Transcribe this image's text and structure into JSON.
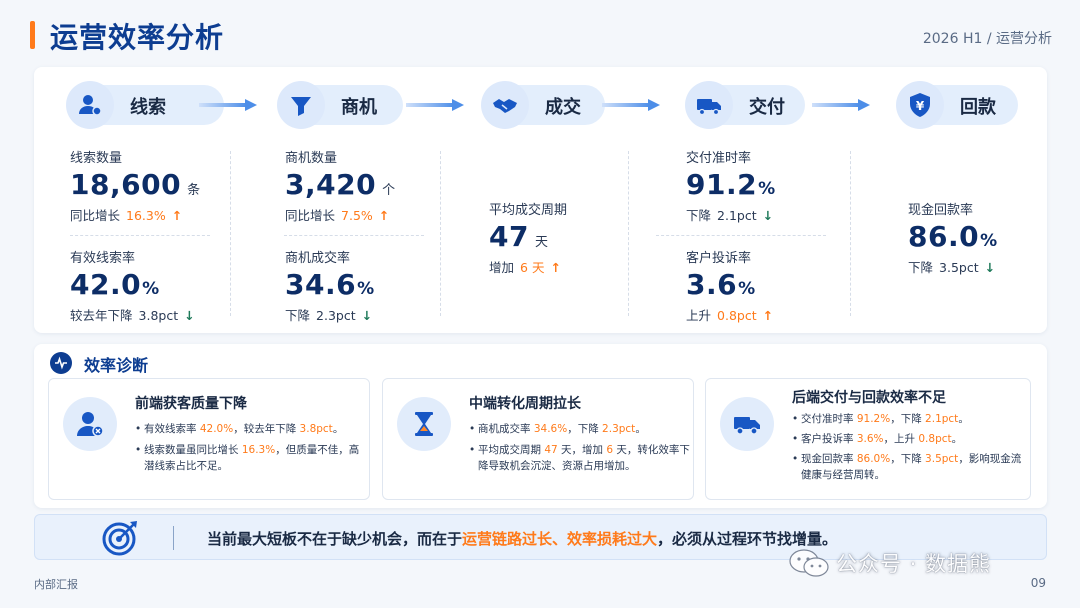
{
  "header": {
    "title": "运营效率分析",
    "subtitle": "2026 H1 / 运营分析"
  },
  "stages": [
    {
      "label": "线索",
      "icon": "user-icon"
    },
    {
      "label": "商机",
      "icon": "funnel-icon"
    },
    {
      "label": "成交",
      "icon": "handshake-icon"
    },
    {
      "label": "交付",
      "icon": "truck-icon"
    },
    {
      "label": "回款",
      "icon": "yen-shield-icon"
    }
  ],
  "metrics": {
    "leads_count": {
      "label": "线索数量",
      "value": "18,600",
      "unit": "条",
      "change_prefix": "同比增长",
      "change_value": "16.3%",
      "trend": "up"
    },
    "valid_lead_rate": {
      "label": "有效线索率",
      "value": "42.0",
      "unit": "%",
      "change_prefix": "较去年下降",
      "change_value": "3.8pct",
      "trend": "down"
    },
    "opportunity_count": {
      "label": "商机数量",
      "value": "3,420",
      "unit": "个",
      "change_prefix": "同比增长",
      "change_value": "7.5%",
      "trend": "up"
    },
    "opportunity_conv_rate": {
      "label": "商机成交率",
      "value": "34.6",
      "unit": "%",
      "change_prefix": "下降",
      "change_value": "2.3pct",
      "trend": "down"
    },
    "avg_deal_cycle": {
      "label": "平均成交周期",
      "value": "47",
      "unit": "天",
      "change_prefix": "增加",
      "change_value": "6 天",
      "trend": "up"
    },
    "on_time_delivery": {
      "label": "交付准时率",
      "value": "91.2",
      "unit": "%",
      "change_prefix": "下降",
      "change_value": "2.1pct",
      "trend": "down"
    },
    "complaint_rate": {
      "label": "客户投诉率",
      "value": "3.6",
      "unit": "%",
      "change_prefix": "上升",
      "change_value": "0.8pct",
      "trend": "up"
    },
    "cash_collection_rate": {
      "label": "现金回款率",
      "value": "86.0",
      "unit": "%",
      "change_prefix": "下降",
      "change_value": "3.5pct",
      "trend": "down"
    }
  },
  "diagnosis": {
    "title": "效率诊断",
    "cards": [
      {
        "title": "前端获客质量下降",
        "icon": "user-x-icon",
        "items": [
          {
            "pre": "有效线索率 ",
            "v1": "42.0%",
            "mid": "，较去年下降 ",
            "v2": "3.8pct",
            "post": "。"
          },
          {
            "pre": "线索数量虽同比增长 ",
            "v1": "16.3%",
            "mid": "，但质量不佳，高潜线索占比不足。",
            "v2": "",
            "post": ""
          }
        ]
      },
      {
        "title": "中端转化周期拉长",
        "icon": "hourglass-icon",
        "items": [
          {
            "pre": "商机成交率 ",
            "v1": "34.6%",
            "mid": "，下降 ",
            "v2": "2.3pct",
            "post": "。"
          },
          {
            "pre": "平均成交周期 ",
            "v1": "47",
            "mid": " 天，增加 ",
            "v2": "6",
            "post": " 天，转化效率下降导致机会沉淀、资源占用增加。"
          }
        ]
      },
      {
        "title": "后端交付与回款效率不足",
        "icon": "truck-icon",
        "items": [
          {
            "pre": "交付准时率 ",
            "v1": "91.2%",
            "mid": "，下降 ",
            "v2": "2.1pct",
            "post": "。"
          },
          {
            "pre": "客户投诉率 ",
            "v1": "3.6%",
            "mid": "，上升 ",
            "v2": "0.8pct",
            "post": "。"
          },
          {
            "pre": "现金回款率 ",
            "v1": "86.0%",
            "mid": "，下降 ",
            "v2": "3.5pct",
            "post": "，影响现金流健康与经营周转。"
          }
        ]
      }
    ]
  },
  "conclusion": {
    "icon": "target-icon",
    "text_pre": "当前最大短板不在于缺少机会，而在于",
    "text_highlight": "运营链路过长、效率损耗过大",
    "text_post": "，必须从过程环节找增量。"
  },
  "footer": {
    "left": "内部汇报",
    "page": "09",
    "watermark": "公众号 · 数据熊",
    "watermark_icon": "wechat-icon"
  },
  "colors": {
    "primary": "#0d3d91",
    "accent": "#ff7a1a",
    "down_arrow": "#1f7a5a",
    "pill_bg": "#e3eefc"
  }
}
